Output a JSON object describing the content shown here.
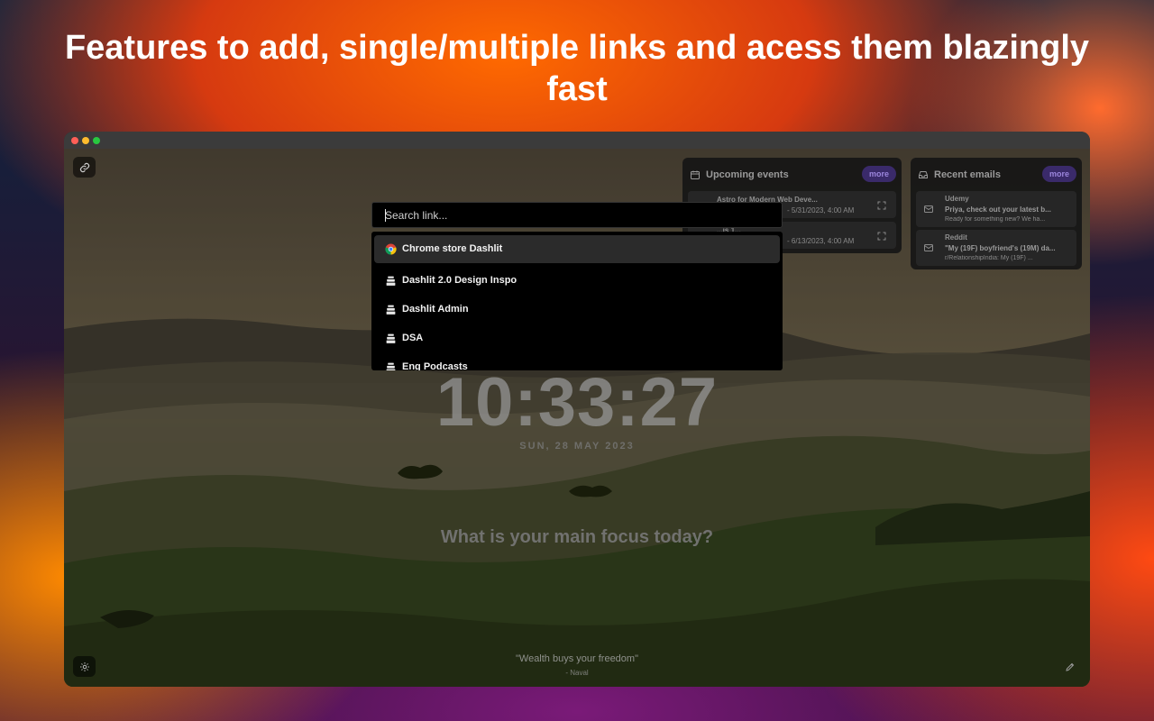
{
  "headline": "Features to add, single/multiple links and acess them blazingly fast",
  "window": {
    "controls": [
      "close",
      "minimize",
      "zoom"
    ]
  },
  "toolbar": {
    "links_icon": "link-icon",
    "settings_icon": "gear-icon",
    "edit_icon": "pencil-icon"
  },
  "search": {
    "placeholder": "Search link...",
    "value": ""
  },
  "links": [
    {
      "label": "Chrome store Dashlit",
      "icon": "chrome-icon",
      "active": true
    },
    {
      "label": "Dashlit 2.0 Design Inspo",
      "icon": "stack-icon",
      "active": false
    },
    {
      "label": "Dashlit Admin",
      "icon": "stack-icon",
      "active": false
    },
    {
      "label": "DSA",
      "icon": "stack-icon",
      "active": false
    },
    {
      "label": "Eng Podcasts",
      "icon": "stack-icon",
      "active": false
    }
  ],
  "events_panel": {
    "title": "Upcoming events",
    "more_label": "more",
    "items": [
      {
        "title": "Astro for Modern Web Deve...",
        "time": "- 5/31/2023, 4:00 AM"
      },
      {
        "title": "...js 1...",
        "time": "- 6/13/2023, 4:00 AM"
      }
    ]
  },
  "emails_panel": {
    "title": "Recent emails",
    "more_label": "more",
    "items": [
      {
        "sender": "Udemy",
        "subject": "Priya, check out your latest b...",
        "preview": "Ready for something new? We ha..."
      },
      {
        "sender": "Reddit",
        "subject": "\"My (19F) boyfriend's (19M) da...",
        "preview": "r/RelationshipIndia: My (19F) ..."
      }
    ]
  },
  "clock": {
    "time": "10:33:27",
    "date": "SUN, 28 MAY 2023"
  },
  "focus_prompt": "What is your main focus today?",
  "quote": {
    "text": "\"Wealth buys your freedom\"",
    "author": "- Naval"
  },
  "colors": {
    "accent_button_bg": "#3a2a6a",
    "accent_button_text": "#9c86dd",
    "dropdown_bg": "#000000",
    "active_item_bg": "#2b2b2b"
  }
}
